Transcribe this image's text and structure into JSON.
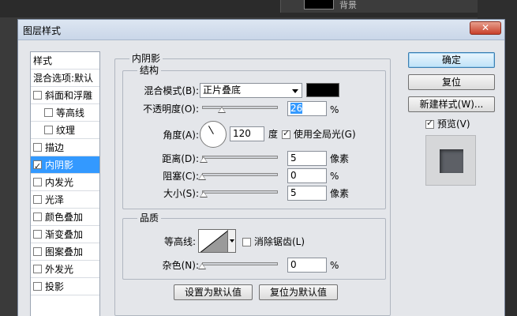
{
  "background": {
    "layer_name": "背景"
  },
  "dialog": {
    "title": "图层样式",
    "close_label": "✕"
  },
  "styles_list": {
    "header": "样式",
    "blend_options": "混合选项:默认",
    "items": [
      {
        "label": "斜面和浮雕",
        "checked": false
      },
      {
        "label": "等高线",
        "checked": false,
        "indent": true
      },
      {
        "label": "纹理",
        "checked": false,
        "indent": true
      },
      {
        "label": "描边",
        "checked": false
      },
      {
        "label": "内阴影",
        "checked": true,
        "selected": true
      },
      {
        "label": "内发光",
        "checked": false
      },
      {
        "label": "光泽",
        "checked": false
      },
      {
        "label": "颜色叠加",
        "checked": false
      },
      {
        "label": "渐变叠加",
        "checked": false
      },
      {
        "label": "图案叠加",
        "checked": false
      },
      {
        "label": "外发光",
        "checked": false
      },
      {
        "label": "投影",
        "checked": false
      }
    ]
  },
  "inner_shadow": {
    "section_title": "内阴影",
    "structure": {
      "title": "结构",
      "blend_mode_label": "混合模式(B):",
      "blend_mode_value": "正片叠底",
      "shadow_color": "#000000",
      "opacity_label": "不透明度(O):",
      "opacity_value": "26",
      "opacity_fraction": 0.26,
      "percent": "%",
      "angle_label": "角度(A):",
      "angle_value": "120",
      "angle_unit": "度",
      "global_light_label": "使用全局光(G)",
      "global_light_checked": true,
      "distance_label": "距离(D):",
      "distance_value": "5",
      "distance_fraction": 0.02,
      "pixels": "像素",
      "choke_label": "阻塞(C):",
      "choke_value": "0",
      "choke_fraction": 0,
      "size_label": "大小(S):",
      "size_value": "5",
      "size_fraction": 0.02
    },
    "quality": {
      "title": "品质",
      "contour_label": "等高线:",
      "anti_alias_label": "消除锯齿(L)",
      "anti_alias_checked": false,
      "noise_label": "杂色(N):",
      "noise_value": "0",
      "noise_fraction": 0
    },
    "set_default_label": "设置为默认值",
    "reset_default_label": "复位为默认值"
  },
  "buttons": {
    "ok": "确定",
    "reset": "复位",
    "new_style": "新建样式(W)...",
    "preview_label": "预览(V)",
    "preview_checked": true
  },
  "colors": {
    "accent_selected": "#3399ff",
    "title_bar": "#c9d6e8",
    "dialog_bg": "#e4e6ea"
  }
}
